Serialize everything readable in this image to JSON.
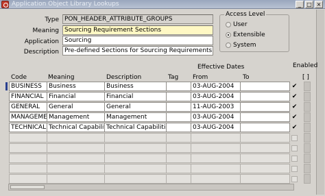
{
  "window": {
    "title": "Application Object Library Lookups",
    "buttons": [
      "_",
      "□",
      "×"
    ]
  },
  "header": {
    "type_label": "Type",
    "type_value": "PON_HEADER_ATTRIBUTE_GROUPS",
    "meaning_label": "Meaning",
    "meaning_value": "Sourcing Requirement Sections",
    "application_label": "Application",
    "application_value": "Sourcing",
    "description_label": "Description",
    "description_value": "Pre-defined Sections for Sourcing Requirements"
  },
  "access_level": {
    "title": "Access Level",
    "options": [
      {
        "label": "User",
        "selected": false
      },
      {
        "label": "Extensible",
        "selected": true
      },
      {
        "label": "System",
        "selected": false
      }
    ]
  },
  "table": {
    "effective_dates_label": "Effective Dates",
    "enabled_label": "Enabled",
    "extra_col_label": "[ ]",
    "columns": [
      "Code",
      "Meaning",
      "Description",
      "Tag",
      "From",
      "To"
    ],
    "rows": [
      {
        "code": "BUSINESS",
        "meaning": "Business",
        "description": "Business",
        "tag": "",
        "from": "03-AUG-2004",
        "to": "",
        "enabled": true
      },
      {
        "code": "FINANCIAL",
        "meaning": "Financial",
        "description": "Financial",
        "tag": "",
        "from": "03-AUG-2004",
        "to": "",
        "enabled": true
      },
      {
        "code": "GENERAL",
        "meaning": "General",
        "description": "General",
        "tag": "",
        "from": "11-AUG-2003",
        "to": "",
        "enabled": true
      },
      {
        "code": "MANAGEMENT",
        "meaning": "Management",
        "description": "Management",
        "tag": "",
        "from": "03-AUG-2004",
        "to": "",
        "enabled": true
      },
      {
        "code": "TECHNICAL C",
        "meaning": "Technical Capabilities",
        "description": "Technical Capabilities",
        "tag": "",
        "from": "03-AUG-2004",
        "to": "",
        "enabled": true
      }
    ],
    "empty_rows": 5
  }
}
